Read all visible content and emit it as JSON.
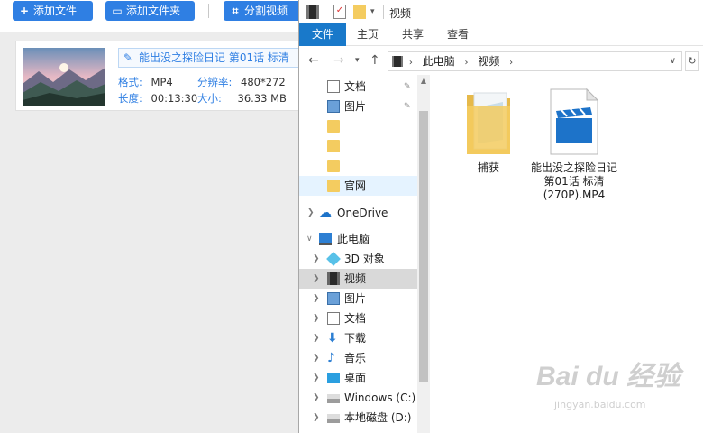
{
  "app": {
    "toolbar": {
      "add_file": "添加文件",
      "add_folder": "添加文件夹",
      "split_video": "分割视频"
    },
    "video": {
      "title": "能出没之探险日记 第01话 标清",
      "format_label": "格式:",
      "format_value": "MP4",
      "resolution_label": "分辨率:",
      "resolution_value": "480*272",
      "duration_label": "长度:",
      "duration_value": "00:13:30",
      "size_label": "大小:",
      "size_value": "36.33 MB"
    }
  },
  "explorer": {
    "title": "视频",
    "ribbon_tabs": [
      "文件",
      "主页",
      "共享",
      "查看"
    ],
    "address": [
      "此电脑",
      "视频"
    ],
    "nav": [
      {
        "label": "文档",
        "icon": "document-icon",
        "pinned": true
      },
      {
        "label": "图片",
        "icon": "picture-icon",
        "pinned": true
      },
      {
        "label": "",
        "icon": "folder-icon"
      },
      {
        "label": "",
        "icon": "folder-icon"
      },
      {
        "label": "",
        "icon": "folder-icon"
      },
      {
        "label": "官网",
        "icon": "folder-icon"
      },
      {
        "label": "OneDrive",
        "icon": "cloud-icon"
      },
      {
        "label": "此电脑",
        "icon": "computer-icon"
      },
      {
        "label": "3D 对象",
        "icon": "3d-objects-icon"
      },
      {
        "label": "视频",
        "icon": "video-icon"
      },
      {
        "label": "图片",
        "icon": "picture-icon"
      },
      {
        "label": "文档",
        "icon": "document-icon"
      },
      {
        "label": "下载",
        "icon": "download-icon"
      },
      {
        "label": "音乐",
        "icon": "music-icon"
      },
      {
        "label": "桌面",
        "icon": "desktop-icon"
      },
      {
        "label": "Windows (C:)",
        "icon": "drive-icon"
      },
      {
        "label": "本地磁盘 (D:)",
        "icon": "drive-icon"
      }
    ],
    "files": [
      {
        "name": "捕获",
        "icon": "folder-icon"
      },
      {
        "name": "能出没之探险日记 第01话 标清(270P).MP4",
        "icon": "video-file-icon"
      }
    ]
  },
  "watermark": {
    "main": "Bai du 经验",
    "sub": "jingyan.baidu.com"
  }
}
